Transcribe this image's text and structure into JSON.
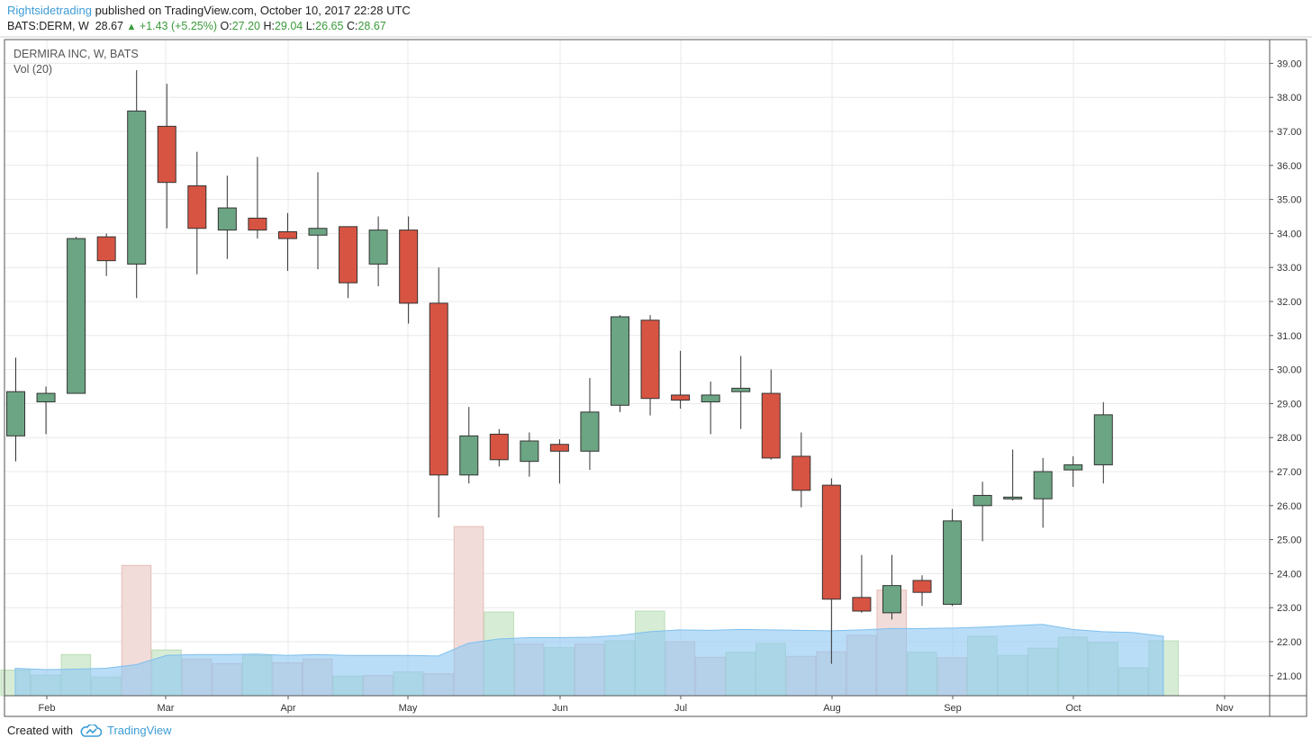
{
  "header": {
    "author": "Rightsidetrading",
    "published_text": " published on TradingView.com, October 10, 2017 22:28 UTC",
    "symbol": "BATS:DERM, W",
    "last": "28.67",
    "change": "+1.43 (+5.25%)",
    "o_label": "O:",
    "o_value": "27.20",
    "h_label": "H:",
    "h_value": "29.04",
    "l_label": "L:",
    "l_value": "26.65",
    "c_label": "C:",
    "c_value": "28.67"
  },
  "legend": {
    "title": "DERMIRA INC, W, BATS",
    "volume": "Vol (20)"
  },
  "footer": {
    "created_with": "Created with",
    "brand": "TradingView"
  },
  "colors": {
    "up": "#6ba583",
    "down": "#d75442",
    "vol_up": "#d7ecd5",
    "vol_down": "#f1dcda",
    "vol_ma": "#8fc8f2",
    "grid": "#e8e8e8",
    "border": "#555555"
  },
  "chart_data": {
    "type": "candlestick",
    "ylim": [
      20.4,
      39.5
    ],
    "y_ticks": [
      "39.00",
      "38.00",
      "37.00",
      "36.00",
      "35.00",
      "34.00",
      "33.00",
      "32.00",
      "31.00",
      "30.00",
      "29.00",
      "28.00",
      "27.00",
      "26.00",
      "25.00",
      "24.00",
      "23.00",
      "22.00",
      "21.00"
    ],
    "x_ticks": [
      "Feb",
      "Mar",
      "Apr",
      "May",
      "Jun",
      "Jul",
      "Aug",
      "Sep",
      "Oct",
      "Nov"
    ],
    "candles": [
      {
        "o": 28.05,
        "h": 30.35,
        "l": 27.3,
        "c": 29.35
      },
      {
        "o": 29.05,
        "h": 29.5,
        "l": 28.1,
        "c": 29.3
      },
      {
        "o": 29.3,
        "h": 33.9,
        "l": 29.3,
        "c": 33.85
      },
      {
        "o": 33.9,
        "h": 34.0,
        "l": 32.75,
        "c": 33.2
      },
      {
        "o": 33.1,
        "h": 38.8,
        "l": 32.1,
        "c": 37.6
      },
      {
        "o": 37.15,
        "h": 38.4,
        "l": 34.15,
        "c": 35.5
      },
      {
        "o": 35.4,
        "h": 36.4,
        "l": 32.8,
        "c": 34.15
      },
      {
        "o": 34.1,
        "h": 35.7,
        "l": 33.25,
        "c": 34.75
      },
      {
        "o": 34.45,
        "h": 36.25,
        "l": 33.85,
        "c": 34.1
      },
      {
        "o": 34.05,
        "h": 34.6,
        "l": 32.9,
        "c": 33.85
      },
      {
        "o": 33.95,
        "h": 35.8,
        "l": 32.95,
        "c": 34.15
      },
      {
        "o": 34.2,
        "h": 34.2,
        "l": 32.1,
        "c": 32.55
      },
      {
        "o": 33.1,
        "h": 34.5,
        "l": 32.45,
        "c": 34.1
      },
      {
        "o": 34.1,
        "h": 34.5,
        "l": 31.35,
        "c": 31.95
      },
      {
        "o": 31.95,
        "h": 33.0,
        "l": 25.65,
        "c": 26.9
      },
      {
        "o": 26.9,
        "h": 28.9,
        "l": 26.65,
        "c": 28.05
      },
      {
        "o": 28.1,
        "h": 28.25,
        "l": 27.15,
        "c": 27.35
      },
      {
        "o": 27.3,
        "h": 28.15,
        "l": 26.85,
        "c": 27.9
      },
      {
        "o": 27.8,
        "h": 27.95,
        "l": 26.65,
        "c": 27.6
      },
      {
        "o": 27.6,
        "h": 29.75,
        "l": 27.05,
        "c": 28.75
      },
      {
        "o": 28.95,
        "h": 31.6,
        "l": 28.75,
        "c": 31.55
      },
      {
        "o": 31.45,
        "h": 31.6,
        "l": 28.65,
        "c": 29.15
      },
      {
        "o": 29.25,
        "h": 30.55,
        "l": 28.85,
        "c": 29.1
      },
      {
        "o": 29.05,
        "h": 29.65,
        "l": 28.1,
        "c": 29.25
      },
      {
        "o": 29.35,
        "h": 30.4,
        "l": 28.25,
        "c": 29.45
      },
      {
        "o": 29.3,
        "h": 30.0,
        "l": 27.35,
        "c": 27.4
      },
      {
        "o": 27.45,
        "h": 28.15,
        "l": 25.95,
        "c": 26.45
      },
      {
        "o": 26.6,
        "h": 26.8,
        "l": 21.35,
        "c": 23.25
      },
      {
        "o": 23.3,
        "h": 24.55,
        "l": 22.85,
        "c": 22.9
      },
      {
        "o": 22.85,
        "h": 24.55,
        "l": 22.65,
        "c": 23.65
      },
      {
        "o": 23.8,
        "h": 23.95,
        "l": 23.05,
        "c": 23.45
      },
      {
        "o": 23.1,
        "h": 25.9,
        "l": 23.05,
        "c": 25.55
      },
      {
        "o": 26.0,
        "h": 26.7,
        "l": 24.95,
        "c": 26.3
      },
      {
        "o": 26.22,
        "h": 27.65,
        "l": 26.15,
        "c": 26.25
      },
      {
        "o": 26.2,
        "h": 27.4,
        "l": 25.35,
        "c": 27.0
      },
      {
        "o": 27.05,
        "h": 27.45,
        "l": 26.55,
        "c": 27.2
      },
      {
        "o": 27.2,
        "h": 29.04,
        "l": 26.65,
        "c": 28.67
      }
    ],
    "volume": {
      "ylim": [
        0,
        3.8
      ],
      "bars": [
        0.56,
        0.45,
        0.9,
        0.4,
        2.85,
        1.0,
        0.8,
        0.7,
        0.88,
        0.72,
        0.8,
        0.42,
        0.44,
        0.52,
        0.48,
        3.7,
        1.83,
        1.13,
        1.05,
        1.13,
        1.2,
        1.85,
        1.18,
        0.84,
        0.95,
        1.14,
        0.86,
        0.96,
        1.32,
        2.31,
        0.95,
        0.83,
        1.3,
        0.88,
        1.04,
        1.28,
        1.16,
        0.61,
        1.2
      ],
      "ma": [
        0.6,
        0.57,
        0.58,
        0.6,
        0.68,
        0.88,
        0.9,
        0.9,
        0.91,
        0.88,
        0.9,
        0.88,
        0.88,
        0.88,
        0.87,
        1.15,
        1.24,
        1.27,
        1.27,
        1.28,
        1.32,
        1.4,
        1.44,
        1.43,
        1.45,
        1.44,
        1.43,
        1.42,
        1.44,
        1.47,
        1.47,
        1.48,
        1.5,
        1.53,
        1.56,
        1.45,
        1.4,
        1.38,
        1.3
      ]
    }
  }
}
